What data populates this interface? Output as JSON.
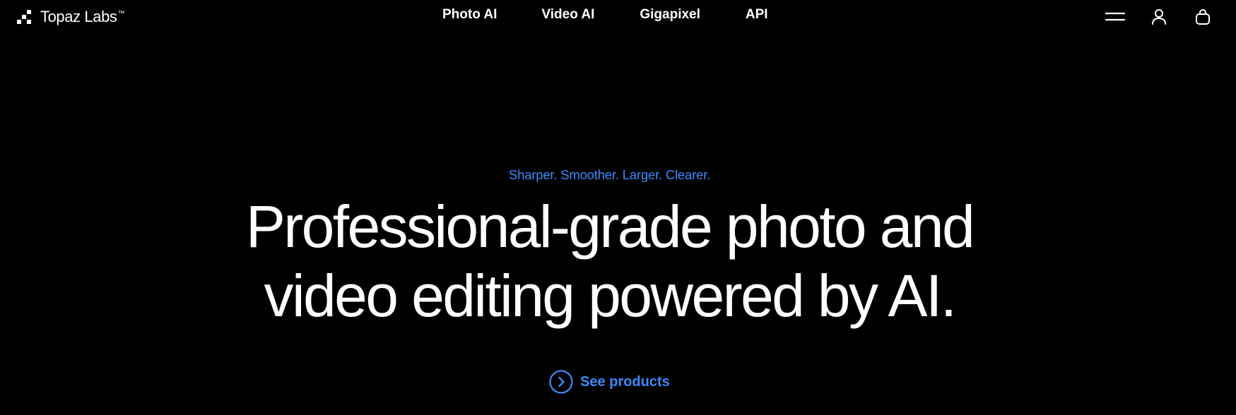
{
  "header": {
    "logo": {
      "text": "Topaz Labs",
      "trademark": "™",
      "icon": "topaz-pixel-logo-icon"
    },
    "nav": [
      {
        "label": "Photo AI"
      },
      {
        "label": "Video AI"
      },
      {
        "label": "Gigapixel"
      },
      {
        "label": "API"
      }
    ],
    "actions": {
      "menu_icon": "hamburger-menu-icon",
      "account_icon": "user-account-icon",
      "cart_icon": "shopping-bag-icon"
    }
  },
  "hero": {
    "eyebrow": "Sharper. Smoother. Larger. Clearer.",
    "headline_line1": "Professional-grade photo and",
    "headline_line2": "video editing powered by AI.",
    "cta": {
      "label": "See products",
      "icon": "chevron-right-circle-icon"
    }
  },
  "colors": {
    "background": "#000000",
    "text": "#ffffff",
    "accent": "#3b8cff"
  }
}
